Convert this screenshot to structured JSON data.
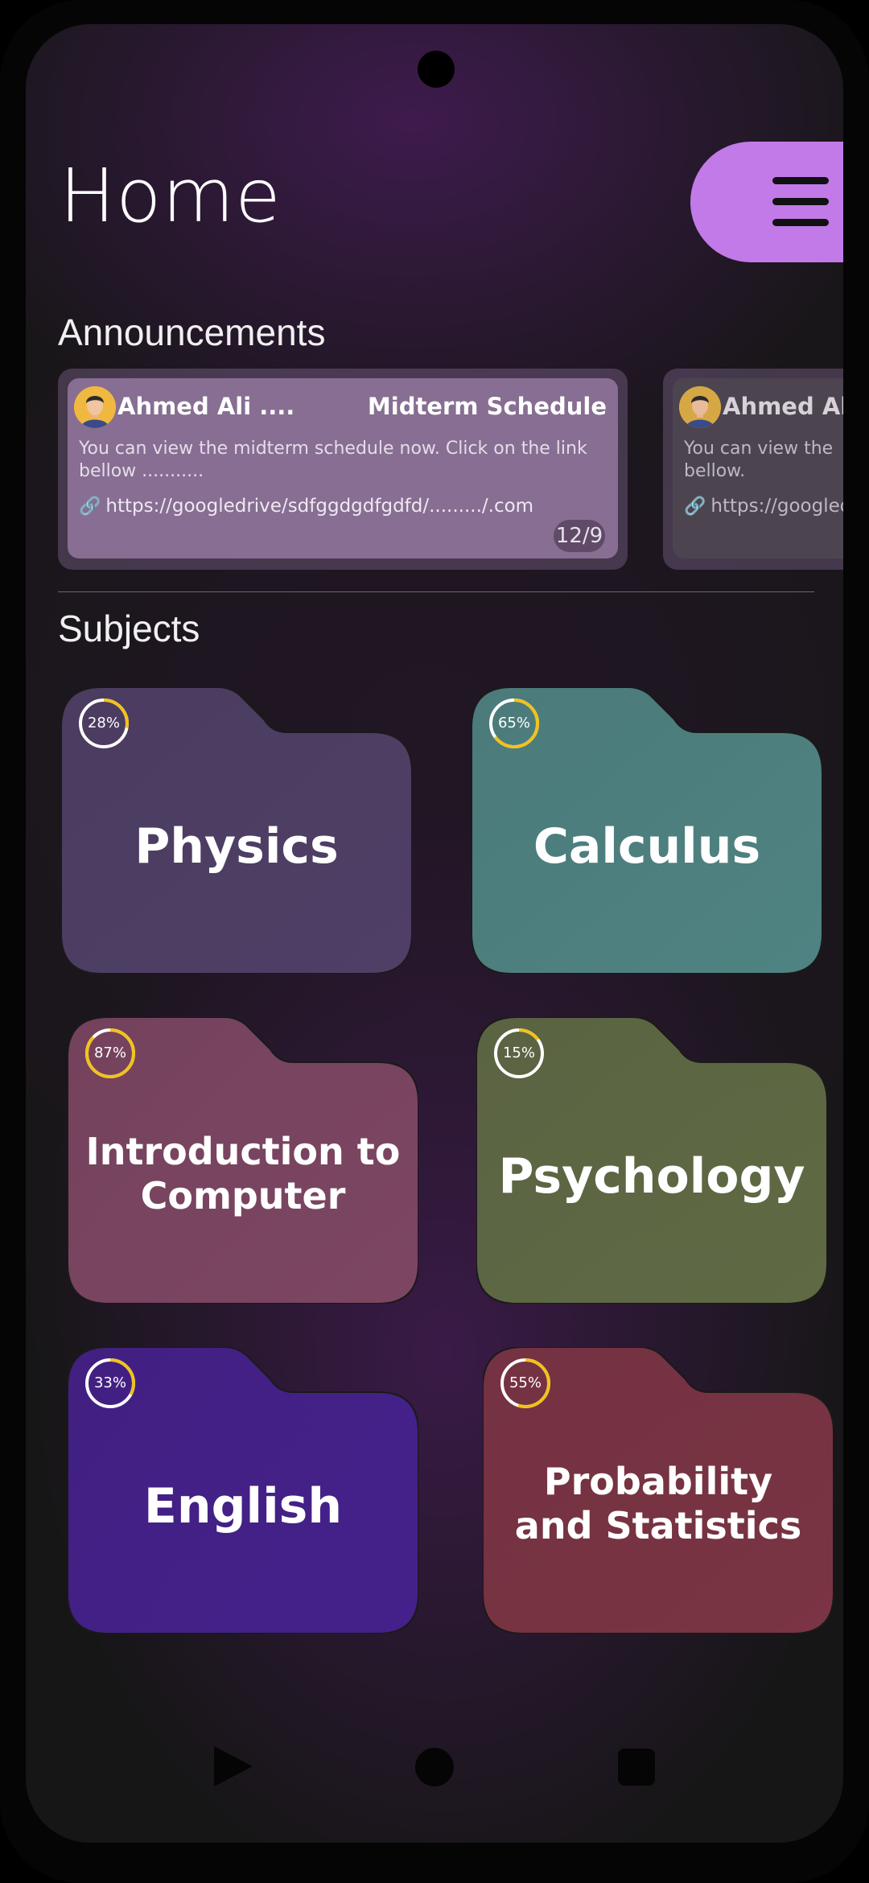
{
  "page": {
    "title": "Home"
  },
  "announcements": {
    "label": "Announcements",
    "items": [
      {
        "author": "Ahmed Ali ....",
        "title": "Midterm Schedule",
        "body": "You can view the midterm schedule now. Click on the link bellow ...........",
        "link": "https://googledrive/sdfggdgdfgdfd/........./.com",
        "date": "12/9"
      },
      {
        "author": "Ahmed Ali",
        "title": "",
        "body": "You can view the bellow.",
        "link": "https://googled"
      }
    ]
  },
  "subjects": {
    "label": "Subjects",
    "items": [
      {
        "name": "Physics",
        "progress_label": "28%",
        "progress": 0.28,
        "color": "#4f3f66"
      },
      {
        "name": "Calculus",
        "progress_label": "65%",
        "progress": 0.65,
        "color": "#4f8382"
      },
      {
        "name": "Introduction to Computer",
        "progress_label": "87%",
        "progress": 0.87,
        "color": "#7c4662"
      },
      {
        "name": "Psychology",
        "progress_label": "15%",
        "progress": 0.15,
        "color": "#5f6a44"
      },
      {
        "name": "English",
        "progress_label": "33%",
        "progress": 0.33,
        "color": "#44218a"
      },
      {
        "name": "Probability and Statistics",
        "progress_label": "55%",
        "progress": 0.55,
        "color": "#7a3443"
      }
    ]
  },
  "icons": {
    "menu": "hamburger-menu-icon",
    "link": "link-icon",
    "avatar": "user-avatar-icon",
    "back": "back-triangle-icon",
    "home": "home-circle-icon",
    "recents": "recents-square-icon"
  },
  "colors": {
    "accent": "#c27ae8",
    "progress_ring": "#f2c21b"
  }
}
